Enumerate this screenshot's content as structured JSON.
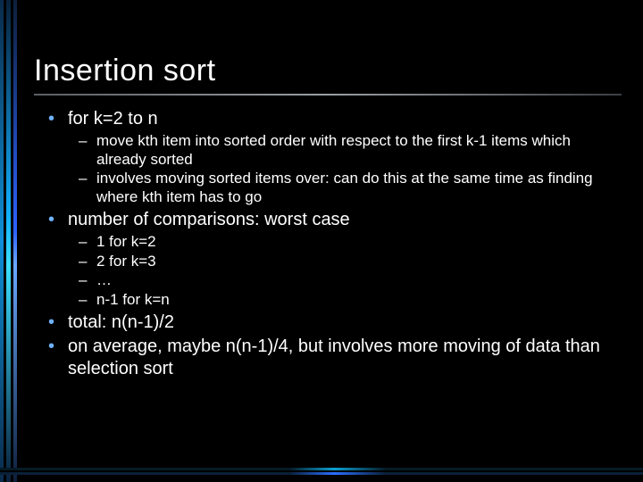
{
  "title": "Insertion sort",
  "bullets": [
    {
      "text": "for k=2 to n",
      "sub": [
        "move kth item into sorted order with respect to the first k-1 items which already sorted",
        "involves moving sorted items over: can do this at the same time as finding where kth item has to go"
      ]
    },
    {
      "text": "number of comparisons: worst case",
      "sub": [
        "1 for k=2",
        "2 for k=3",
        "…",
        "n-1 for k=n"
      ]
    },
    {
      "text": "total: n(n-1)/2",
      "sub": []
    },
    {
      "text": "on average, maybe n(n-1)/4, but involves more moving of data than selection sort",
      "sub": []
    }
  ]
}
